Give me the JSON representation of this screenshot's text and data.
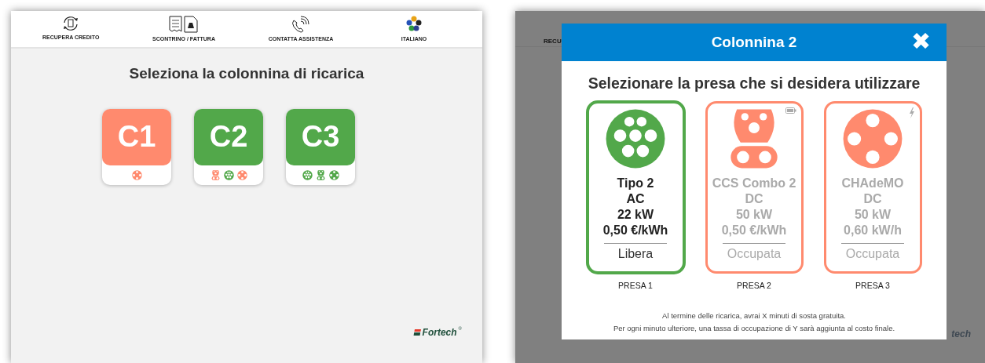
{
  "main_screen": {
    "menu": [
      {
        "kind": "credit",
        "label": "RECUPERA CREDITO"
      },
      {
        "kind": "receipt",
        "label": "SCONTRINO / FATTURA"
      },
      {
        "kind": "phone",
        "label": "CONTATTA ASSISTENZA"
      },
      {
        "kind": "language",
        "label": "ITALIANO"
      }
    ],
    "title": "Seleziona la colonnina di ricarica",
    "stations": [
      {
        "label": "C1",
        "available": false,
        "connectors": [
          {
            "kind": "chademo",
            "available": false
          }
        ]
      },
      {
        "label": "C2",
        "available": true,
        "connectors": [
          {
            "kind": "ccs",
            "available": false
          },
          {
            "kind": "type2",
            "available": true
          },
          {
            "kind": "chademo",
            "available": false
          }
        ]
      },
      {
        "label": "C3",
        "available": true,
        "connectors": [
          {
            "kind": "type2",
            "available": true
          },
          {
            "kind": "ccs",
            "available": true
          },
          {
            "kind": "chademo",
            "available": true
          }
        ]
      }
    ],
    "logo": {
      "text": "Fortech",
      "mark": "®"
    }
  },
  "dimmed_screen": {
    "menu_fragment": "RECU",
    "logo_fragment": "tech"
  },
  "dialog": {
    "title": "Colonnina 2",
    "close": "✖",
    "prompt": "Selezionare la presa che si desidera utilizzare",
    "sockets": [
      {
        "kind": "type2",
        "available": true,
        "selected": true,
        "name": "Tipo 2",
        "current": "AC",
        "power": "22 kW",
        "price": "0,50 €/kWh",
        "status": "Libera",
        "label": "PRESA 1"
      },
      {
        "kind": "ccs",
        "available": false,
        "selected": false,
        "indicator": {
          "kind": "battery"
        },
        "name": "CCS Combo 2",
        "current": "DC",
        "power": "50 kW",
        "price": "0,50 €/kWh",
        "status": "Occupata",
        "label": "PRESA 2"
      },
      {
        "kind": "chademo",
        "available": false,
        "selected": false,
        "indicator": {
          "kind": "bolt"
        },
        "name": "CHAdeMO",
        "current": "DC",
        "power": "50 kW",
        "price": "0,60 kW/h",
        "status": "Occupata",
        "label": "PRESA 3"
      }
    ],
    "notes": [
      "Al termine delle ricarica, avrai X minuti di sosta gratuita.",
      "Per ogni minuto ulteriore, una tassa di occupazione di Y sarà aggiunta al costo finale."
    ]
  }
}
